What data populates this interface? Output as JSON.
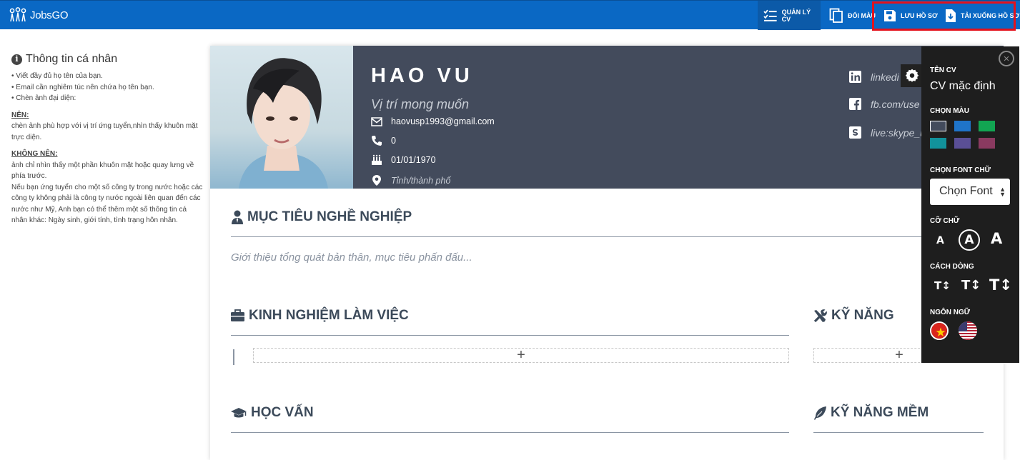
{
  "app": {
    "logo_text": "JobsGO"
  },
  "topnav": {
    "manage": "QUẢN LÝ CV",
    "color": "ĐỔI MÀU",
    "save": "LƯU HỒ SƠ",
    "download": "TẢI XUỐNG HỒ SƠ"
  },
  "tips": {
    "title": "Thông tin cá nhân",
    "bullets": [
      "• Viết đầy đủ họ tên của bạn.",
      "• Email cần nghiêm túc nên chứa họ tên bạn.",
      "• Chèn ảnh đại diện:"
    ],
    "should_heading": "NÊN:",
    "should_text": "chèn ảnh phù hợp với vị trí ứng tuyển,nhìn thấy khuôn mặt trực diện.",
    "shouldnot_heading": "KHÔNG NÊN:",
    "shouldnot_text": "ảnh chỉ nhìn thấy một phần khuôn mặt hoặc quay lưng về phía trước.",
    "extra_text": "Nếu bạn ứng tuyển cho một số công ty trong nước hoặc các công ty không phải là công ty nước ngoài liên quan đến các nước như Mỹ, Anh bạn có thể thêm một số thông tin cá nhân khác: Ngày sinh, giới tính, tình trạng hôn nhân."
  },
  "cv": {
    "name": "HAO VU",
    "position_placeholder": "Vị trí mong muốn",
    "email": "haovusp1993@gmail.com",
    "phone": "0",
    "birthday": "01/01/1970",
    "city_placeholder": "Tỉnh/thành phố",
    "linkedin": "linkedi",
    "facebook": "fb.com/use",
    "skype": "live:skype_u",
    "sections": {
      "objective": "MỤC TIÊU NGHỀ NGHIỆP",
      "objective_placeholder": "Giới thiệu tổng quát bản thân, mục tiêu phấn đấu...",
      "experience": "KINH NGHIỆM LÀM VIỆC",
      "skills": "KỸ NĂNG",
      "education": "HỌC VẤN",
      "soft_skills": "KỸ NĂNG MỀM"
    },
    "add_label": "+"
  },
  "panel": {
    "cv_name_label": "TÊN CV",
    "cv_name_value": "CV mặc định",
    "color_label": "CHỌN MÀU",
    "colors": [
      "#434b5c",
      "#1f74c9",
      "#12a552",
      "#12929b",
      "#5a4f96",
      "#8a3a60"
    ],
    "font_label": "CHỌN FONT CHỮ",
    "font_value": "Chọn Font",
    "size_label": "CỠ CHỮ",
    "size_glyph": "A",
    "spacing_label": "CÁCH DÒNG",
    "spacing_glyph": "T↕",
    "language_label": "NGÔN NGỮ",
    "close_glyph": "×"
  }
}
